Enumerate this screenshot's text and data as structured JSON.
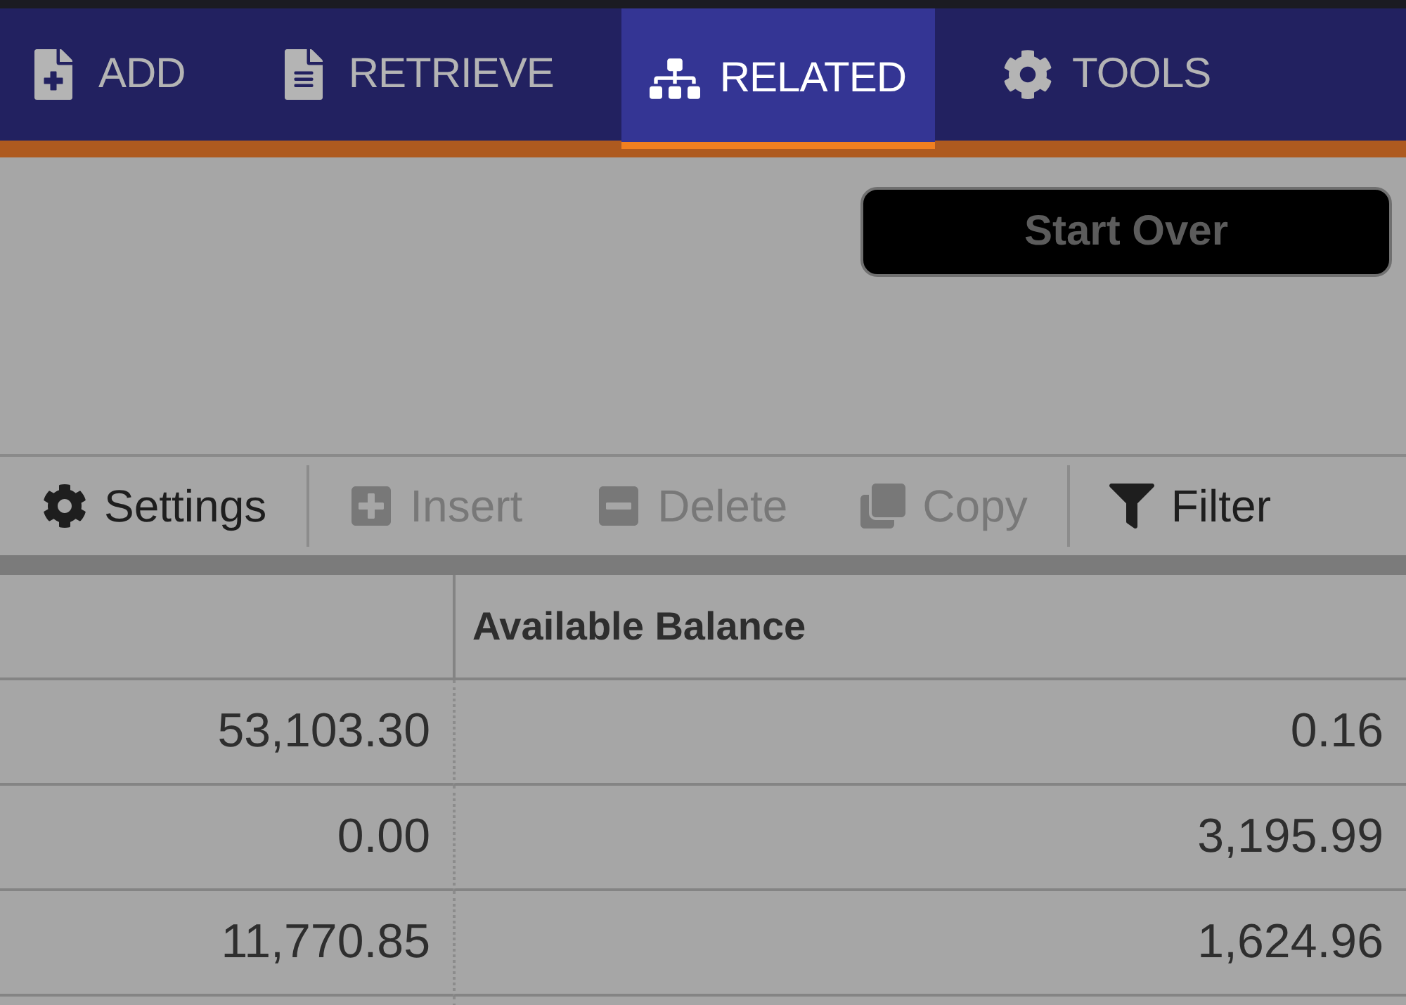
{
  "nav_tabs": [
    {
      "label": "ADD",
      "kind": "add",
      "selected": false
    },
    {
      "label": "RETRIEVE",
      "kind": "retrieve",
      "selected": false
    },
    {
      "label": "RELATED",
      "kind": "related",
      "selected": true
    },
    {
      "label": "TOOLS",
      "kind": "tools",
      "selected": false
    }
  ],
  "start_over_button": {
    "label": "Start Over"
  },
  "toolbar": [
    {
      "label": "Settings",
      "kind": "gear",
      "disabled": false
    },
    {
      "label": "Insert",
      "kind": "plus",
      "disabled": true
    },
    {
      "label": "Delete",
      "kind": "minus",
      "disabled": true
    },
    {
      "label": "Copy",
      "kind": "copy",
      "disabled": true
    },
    {
      "label": "Filter",
      "kind": "filter",
      "disabled": false
    }
  ],
  "table": {
    "columns": [
      "",
      "Available Balance"
    ],
    "rows": [
      [
        "53,103.30",
        "0.16"
      ],
      [
        "0.00",
        "3,195.99"
      ],
      [
        "11,770.85",
        "1,624.96"
      ]
    ]
  }
}
